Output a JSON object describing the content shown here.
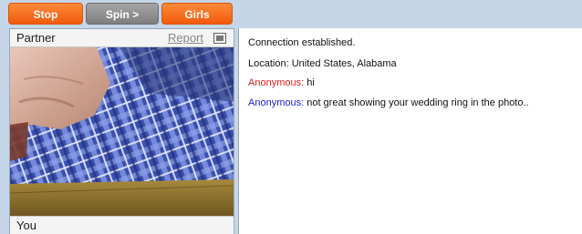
{
  "toolbar": {
    "stop_label": "Stop",
    "spin_label": "Spin >",
    "girls_label": "Girls"
  },
  "partner_panel": {
    "label": "Partner",
    "report_label": "Report",
    "expand_icon": "expand-icon"
  },
  "self_panel": {
    "label": "You"
  },
  "chat": {
    "status_connected": "Connection established.",
    "location": "Location: United States, Alabama",
    "messages": [
      {
        "sender": "Anonymous:",
        "text": " hi",
        "color": "#e0201c"
      },
      {
        "sender": "Anonymous:",
        "text": " not great showing your wedding ring in the photo..",
        "color": "#1a22d0"
      }
    ]
  },
  "colors": {
    "accent_orange": "#f05a0a",
    "button_gray": "#8a8a8a",
    "background": "#c5d6e9"
  }
}
